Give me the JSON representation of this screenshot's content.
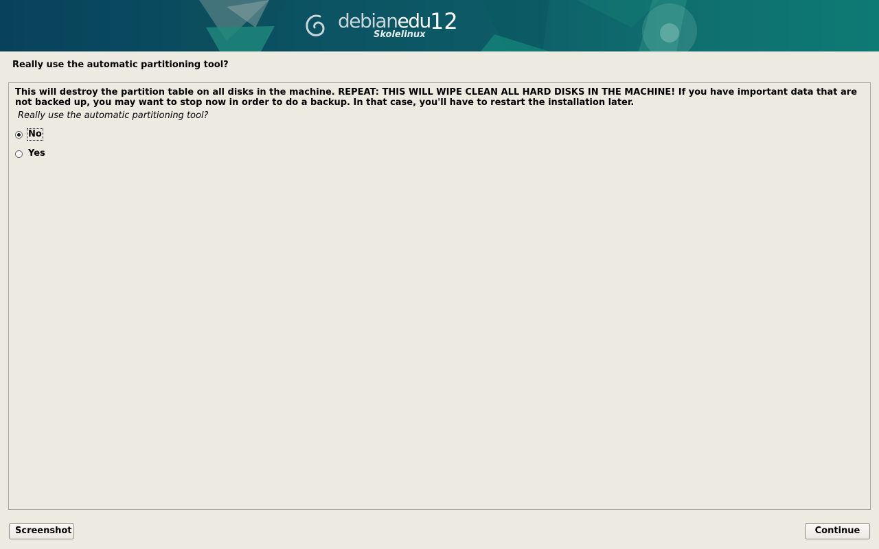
{
  "banner": {
    "logo_word_part1": "debian",
    "logo_word_part2": "edu",
    "logo_version": "12",
    "logo_subtitle": "Skolelinux"
  },
  "page": {
    "title": "Really use the automatic partitioning tool?"
  },
  "panel": {
    "description": "This will destroy the partition table on all disks in the machine. REPEAT: THIS WILL WIPE CLEAN ALL HARD DISKS IN THE MACHINE! If you have important data that are not backed up, you may want to stop now in order to do a backup. In that case, you'll have to restart the installation later.",
    "question": "Really use the automatic partitioning tool?",
    "options": [
      {
        "label": "No",
        "selected": true
      },
      {
        "label": "Yes",
        "selected": false
      }
    ]
  },
  "buttons": {
    "screenshot": "Screenshot",
    "continue": "Continue"
  },
  "colors": {
    "background": "#edeae2",
    "banner_dark": "#07425a",
    "banner_teal": "#0e7a74"
  }
}
